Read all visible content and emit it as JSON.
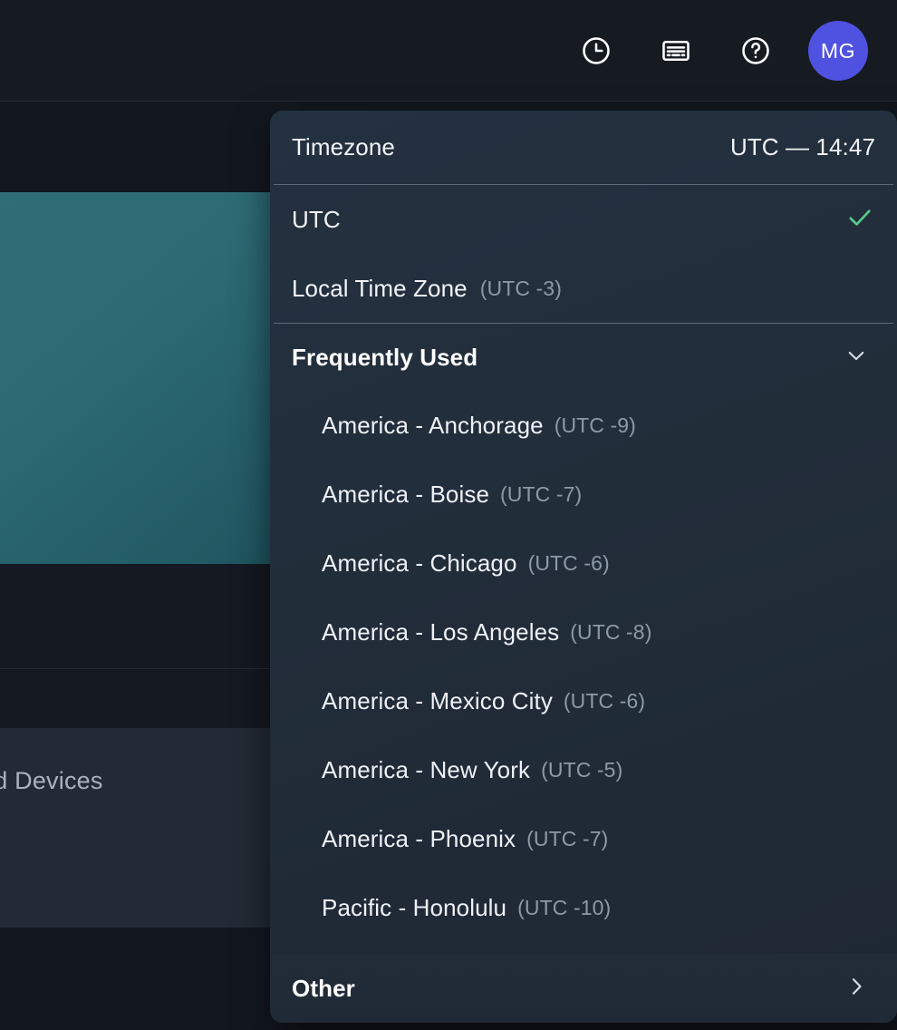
{
  "topbar": {
    "icons": [
      {
        "name": "clock-icon",
        "label": "Recent"
      },
      {
        "name": "changelog-icon",
        "label": "What's new"
      },
      {
        "name": "help-icon",
        "label": "Help"
      }
    ],
    "avatar_initials": "MG",
    "avatar_color": "#4f51e0"
  },
  "background": {
    "devices_label": "ed Devices"
  },
  "dropdown": {
    "header": {
      "title": "Timezone",
      "value": "UTC — 14:47"
    },
    "primary_options": [
      {
        "label": "UTC",
        "offset": "",
        "selected": true
      },
      {
        "label": "Local Time Zone",
        "offset": "(UTC -3)",
        "selected": false
      }
    ],
    "group": {
      "title": "Frequently Used",
      "expanded": true,
      "chevron": "chevron-down-icon",
      "items": [
        {
          "label": "America - Anchorage",
          "offset": "(UTC -9)"
        },
        {
          "label": "America - Boise",
          "offset": "(UTC -7)"
        },
        {
          "label": "America - Chicago",
          "offset": "(UTC -6)"
        },
        {
          "label": "America - Los Angeles",
          "offset": "(UTC -8)"
        },
        {
          "label": "America - Mexico City",
          "offset": "(UTC -6)"
        },
        {
          "label": "America - New York",
          "offset": "(UTC -5)"
        },
        {
          "label": "America - Phoenix",
          "offset": "(UTC -7)"
        },
        {
          "label": "Pacific - Honolulu",
          "offset": "(UTC -10)"
        }
      ]
    },
    "footer": {
      "label": "Other",
      "chevron": "chevron-right-icon"
    },
    "colors": {
      "check": "#57c98a",
      "panel_bg": "#243140",
      "divider": "#5d6a78",
      "offset_text": "#8e9aa8"
    }
  }
}
